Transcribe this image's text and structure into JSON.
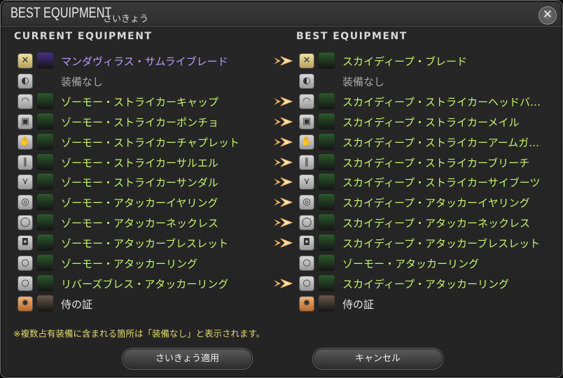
{
  "window": {
    "title": "BEST EQUIPMENT",
    "subtitle": "さいきょう",
    "close_glyph": "✕"
  },
  "columns": {
    "current_header": "CURRENT EQUIPMENT",
    "best_header": "BEST EQUIPMENT"
  },
  "current": [
    {
      "slot_icon": "sword-icon",
      "name": "マンダヴィラス・サムライブレード",
      "color": "#b79cff",
      "icon_bg": "#4a2f8a"
    },
    {
      "slot_icon": "shield-icon",
      "name": "装備なし",
      "color": "#a8a8a8",
      "icon_bg": ""
    },
    {
      "slot_icon": "head-icon",
      "name": "ゾーモー・ストライカーキャップ",
      "color": "#c6f26e",
      "icon_bg": "#2c5a2c"
    },
    {
      "slot_icon": "body-icon",
      "name": "ゾーモー・ストライカーポンチョ",
      "color": "#c6f26e",
      "icon_bg": "#2c5a2c"
    },
    {
      "slot_icon": "hands-icon",
      "name": "ゾーモー・ストライカーチャプレット",
      "color": "#c6f26e",
      "icon_bg": "#2c5a2c"
    },
    {
      "slot_icon": "legs-icon",
      "name": "ゾーモー・ストライカーサルエル",
      "color": "#c6f26e",
      "icon_bg": "#2c5a2c"
    },
    {
      "slot_icon": "feet-icon",
      "name": "ゾーモー・ストライカーサンダル",
      "color": "#c6f26e",
      "icon_bg": "#2c5a2c"
    },
    {
      "slot_icon": "earring-icon",
      "name": "ゾーモー・アタッカーイヤリング",
      "color": "#c6f26e",
      "icon_bg": "#2c5a2c"
    },
    {
      "slot_icon": "necklace-icon",
      "name": "ゾーモー・アタッカーネックレス",
      "color": "#c6f26e",
      "icon_bg": "#2c5a2c"
    },
    {
      "slot_icon": "bracelet-icon",
      "name": "ゾーモー・アタッカーブレスレット",
      "color": "#c6f26e",
      "icon_bg": "#2c5a2c"
    },
    {
      "slot_icon": "ring-icon",
      "name": "ゾーモー・アタッカーリング",
      "color": "#c6f26e",
      "icon_bg": "#2c5a2c"
    },
    {
      "slot_icon": "ring-icon",
      "name": "リバーズブレス・アタッカーリング",
      "color": "#c6f26e",
      "icon_bg": "#2c5a2c"
    },
    {
      "slot_icon": "crest-icon",
      "name": "侍の証",
      "color": "#e8e8e8",
      "icon_bg": "#6a5a4a"
    }
  ],
  "best": [
    {
      "slot_icon": "sword-icon",
      "name": "スカイディープ・ブレード",
      "color": "#c6f26e",
      "icon_bg": "#2c5a2c",
      "arrow": true
    },
    {
      "slot_icon": "shield-icon",
      "name": "装備なし",
      "color": "#a8a8a8",
      "icon_bg": "",
      "arrow": false
    },
    {
      "slot_icon": "head-icon",
      "name": "スカイディープ・ストライカーヘッドバ…",
      "color": "#c6f26e",
      "icon_bg": "#2c5a2c",
      "arrow": true
    },
    {
      "slot_icon": "body-icon",
      "name": "スカイディープ・ストライカーメイル",
      "color": "#c6f26e",
      "icon_bg": "#2c5a2c",
      "arrow": true
    },
    {
      "slot_icon": "hands-icon",
      "name": "スカイディープ・ストライカーアームガ…",
      "color": "#c6f26e",
      "icon_bg": "#2c5a2c",
      "arrow": true
    },
    {
      "slot_icon": "legs-icon",
      "name": "スカイディープ・ストライカーブリーチ",
      "color": "#c6f26e",
      "icon_bg": "#2c5a2c",
      "arrow": true
    },
    {
      "slot_icon": "feet-icon",
      "name": "スカイディープ・ストライカーサイブーツ",
      "color": "#c6f26e",
      "icon_bg": "#2c5a2c",
      "arrow": true
    },
    {
      "slot_icon": "earring-icon",
      "name": "スカイディープ・アタッカーイヤリング",
      "color": "#c6f26e",
      "icon_bg": "#2c5a2c",
      "arrow": true
    },
    {
      "slot_icon": "necklace-icon",
      "name": "スカイディープ・アタッカーネックレス",
      "color": "#c6f26e",
      "icon_bg": "#2c5a2c",
      "arrow": true
    },
    {
      "slot_icon": "bracelet-icon",
      "name": "スカイディープ・アタッカーブレスレット",
      "color": "#c6f26e",
      "icon_bg": "#2c5a2c",
      "arrow": true
    },
    {
      "slot_icon": "ring-icon",
      "name": "ゾーモー・アタッカーリング",
      "color": "#c6f26e",
      "icon_bg": "#2c5a2c",
      "arrow": false
    },
    {
      "slot_icon": "ring-icon",
      "name": "スカイディープ・アタッカーリング",
      "color": "#c6f26e",
      "icon_bg": "#2c5a2c",
      "arrow": true
    },
    {
      "slot_icon": "crest-icon",
      "name": "侍の証",
      "color": "#e8e8e8",
      "icon_bg": "#6a5a4a",
      "arrow": false
    }
  ],
  "note": "※複数占有装備に含まれる箇所は「装備なし」と表示されます。",
  "buttons": {
    "apply_label": "さいきょう適用",
    "cancel_label": "キャンセル"
  },
  "colors": {
    "arrow": "#f0b060",
    "note": "#e0d96a"
  }
}
